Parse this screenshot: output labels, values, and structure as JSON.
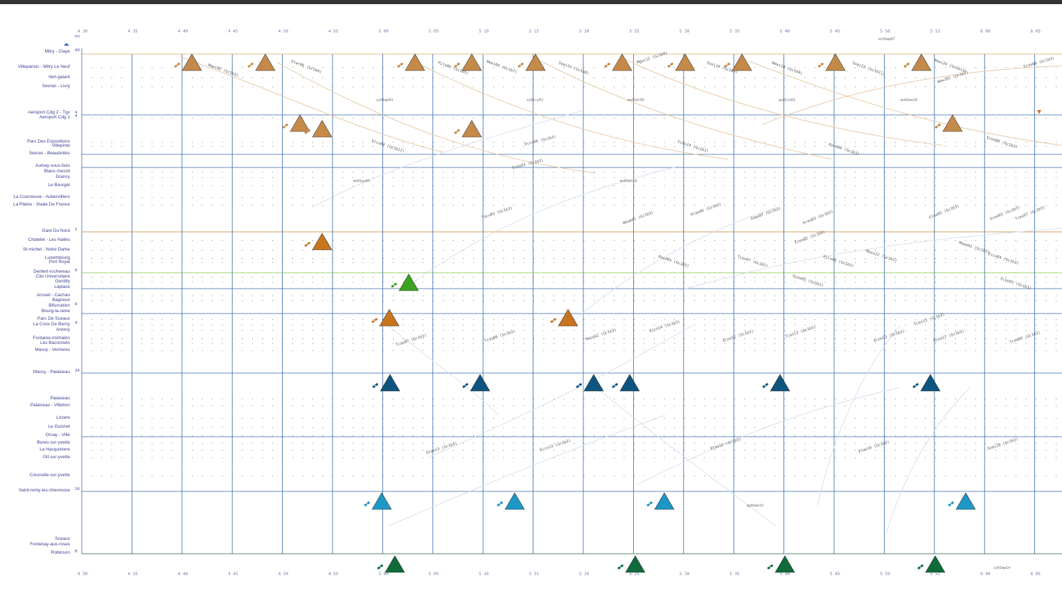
{
  "window": {
    "unit_label": "mi"
  },
  "time_axis": {
    "ticks": [
      "4 30",
      "4 35",
      "4 40",
      "4 45",
      "4 50",
      "4 55",
      "5 00",
      "5 05",
      "5 10",
      "5 15",
      "5 20",
      "5 25",
      "5 30",
      "5 35",
      "5 40",
      "5 45",
      "5 50",
      "5 51",
      "6 00",
      "6 05"
    ]
  },
  "stations": [
    "Mitry - Claye",
    "Villeparisis - Mitry Le Neuf",
    "Vert-galant",
    "Sevran - Livry",
    "Aeroport Cdg 2 - Tgv",
    "Aeroport Cdg 1",
    "Parc Des Expositions",
    "Villepinte",
    "Sevran - Beaudottes",
    "Aulnay-sous-bois",
    "Blanc-mesnil",
    "Drancy",
    "Le Bourget",
    "La Courneuve - Aubervilliers",
    "La Plaine - Stade De France",
    "Gare Du Nord",
    "Chatelet - Les Halles",
    "St-michel - Notre Dame",
    "Luxembourg",
    "Port Royal",
    "Denfert-rochereau",
    "Cite Universitaire",
    "Gentilly",
    "Laplace",
    "Arcueil - Cachan",
    "Bagneux",
    "Bifurcation",
    "Bourg-la-reine",
    "Parc De Sceaux",
    "La Croix De Berny",
    "Antony",
    "Fontaine-michalon",
    "Les Baconnets",
    "Massy - Verrieres",
    "Massy - Palaiseau",
    "Palaiseau",
    "Palaiseau - Villebon",
    "Lozere",
    "Le Guichet",
    "Orsay - Ville",
    "Bures-sur-yvette",
    "La Hacquiniere",
    "Gif-sur-yvette",
    "Courcelle-sur-yvette",
    "Saint-remy-les-chevreuse",
    "Sceaux",
    "Fontenay-aux-roses",
    "Robinson"
  ],
  "track_counts": [
    "40",
    "4",
    "4",
    "2",
    "6",
    "6",
    "4",
    "24",
    "16",
    "8"
  ],
  "train_labels": [
    "Wewi06 (Gc1b3)",
    "Etar06 (Gc1b4)",
    "Pilo06 (Gc1b5)",
    "Wewi04 (Gc1b7)",
    "Soai14 (Gc1b8)",
    "Mgwi12 (Gc1b9)",
    "Soai16 (Gc1b9)",
    "Wewi18 (Gc1b9)",
    "Soai22 (Gc1b11)",
    "Wewi24 (Gc1b13)",
    "Etco04 (Gc1b12)",
    "Ecco06 (Gc1b3)",
    "Eceu14 (Gc1b3)",
    "Kecd06 (Gc1b3)",
    "Ecoo06 (Gc1b3)",
    "Eceo01 (Gc1b3)",
    "Tacu03 (Gc1b3)",
    "Eceo02 (Gc1b5)",
    "Wewe01 (Gc1b3)",
    "Mowe01 (Gc1b3)",
    "Klan05 (Gc1b3)",
    "Imao07 (Gc1b3)",
    "Kreo03 (Gc1b3)",
    "Elao05 (Gc1b3)",
    "Ecoo03 (Gc1b3)",
    "Tcas07 (Gc1b3)",
    "Ecco04 (Gc1b3)",
    "Maso22 (Gc1b3)",
    "Pilo06 (Gc1b3)",
    "Kecd05 (Gc1b3)",
    "Tcas07 (Gc1b1)",
    "Eceo05 (Gc1b3)",
    "Ecoo01 (Gc1b3)",
    "Ecco14 (Gc1b3)",
    "Ecoo12 (Gc1b3)",
    "Tcas13 (Gc1b3)",
    "Ecoo23 (Gc1b3)",
    "Ecoo27 (Gc1b3)",
    "Tcaa05 (Gc1b3)",
    "Tcas07 (Gc1b3)",
    "Tcas08 (Gc1b3)",
    "Maso62 (Gc1b3)",
    "Etao13 (Gc1b3)",
    "Ecco13 (Gc1b3)",
    "Etao15 (Gc1b3)",
    "Etao16 (Gc1b3)",
    "Soai28 (Gc1b3)",
    "Wewi01 (Gc1b3)",
    "Fcoo08 (Gc1b3)",
    "Tcas13 (Gc1b3)"
  ],
  "path_labels": [
    "zy01mp03",
    "zy01ry02",
    "mo01dr05",
    "gu01lo01",
    "mo01mo18",
    "mo01po05",
    "mo01mo18",
    "dr01mp07",
    "mp01mo15",
    "zz01mp14"
  ],
  "colors": {
    "rer_b_north": "#c48a4a",
    "rer_b_gare": "#c8761e",
    "rer_b_mid": "#c8741f",
    "rer_b_green": "#3aa320",
    "massy": "#0d557f",
    "saint_remy": "#1d97c5",
    "robinson": "#0f6b3a",
    "grid": "#2f64a8"
  }
}
